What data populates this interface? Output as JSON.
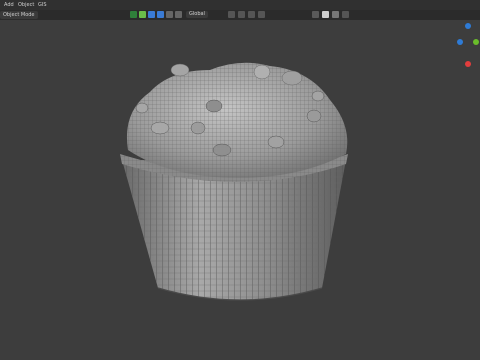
{
  "header": {
    "menus": [
      "Add",
      "Object",
      "GIS"
    ]
  },
  "toolbar": {
    "mode_label": "Object Mode",
    "transform_orientation": "Global",
    "overlay_icons": [
      "overlay-icon",
      "gizmo-icon",
      "xray-icon",
      "shading-wire-icon",
      "shading-solid-icon",
      "shading-material-icon",
      "shading-render-icon",
      "filter-icon"
    ]
  },
  "gizmo": {
    "axes": [
      {
        "name": "z-axis",
        "color": "#2e7bd6"
      },
      {
        "name": "y-axis",
        "color": "#6abd2a"
      },
      {
        "name": "x-axis",
        "color": "#e23d3d"
      }
    ]
  },
  "model": {
    "name": "cupcake-wireframe-mesh",
    "mesh_color": "#9a9a9a",
    "wire_color": "#6c6c6c"
  }
}
